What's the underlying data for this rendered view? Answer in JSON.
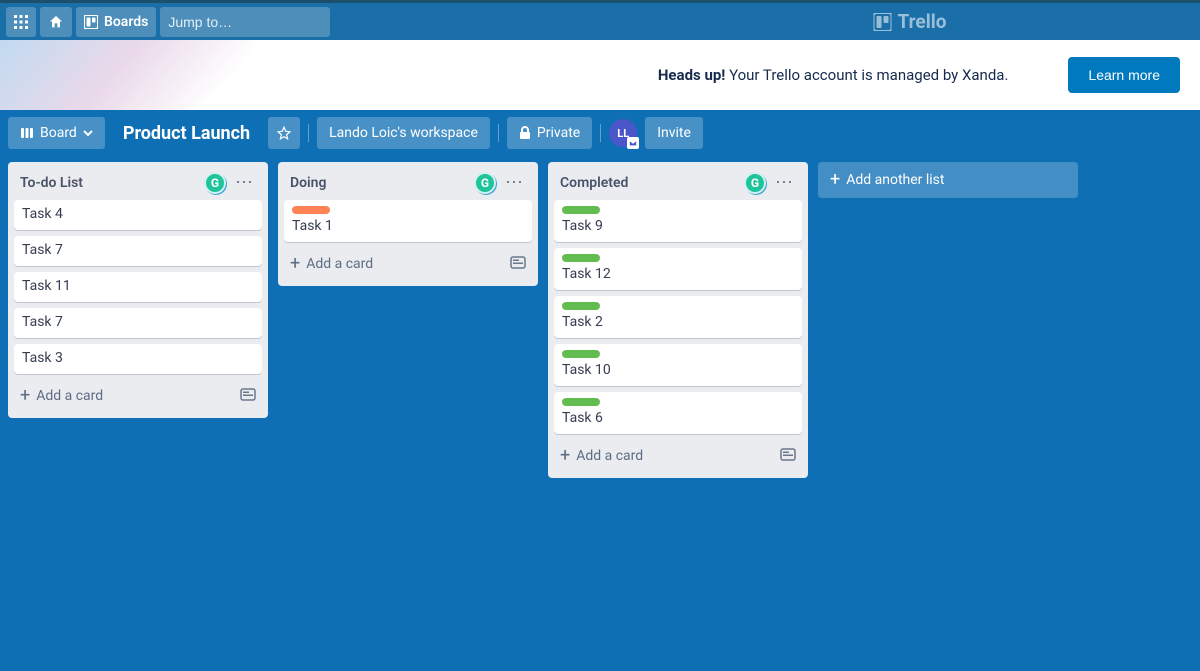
{
  "topbar": {
    "boards_label": "Boards",
    "search_placeholder": "Jump to…",
    "brand": "Trello"
  },
  "banner": {
    "bold": "Heads up!",
    "text": " Your Trello account is managed by Xanda.",
    "button": "Learn more"
  },
  "boardheader": {
    "board_btn": "Board",
    "board_name": "Product Launch",
    "workspace": "Lando Loic's workspace",
    "visibility": "Private",
    "avatar": "LL",
    "invite": "Invite"
  },
  "lists": [
    {
      "title": "To-do List",
      "cards": [
        {
          "title": "Task 4",
          "label": null
        },
        {
          "title": "Task 7",
          "label": null
        },
        {
          "title": "Task 11",
          "label": null
        },
        {
          "title": "Task 7",
          "label": null
        },
        {
          "title": "Task 3",
          "label": null
        }
      ]
    },
    {
      "title": "Doing",
      "cards": [
        {
          "title": "Task 1",
          "label": "orange"
        }
      ]
    },
    {
      "title": "Completed",
      "cards": [
        {
          "title": "Task 9",
          "label": "green"
        },
        {
          "title": "Task 12",
          "label": "green"
        },
        {
          "title": "Task 2",
          "label": "green"
        },
        {
          "title": "Task 10",
          "label": "green"
        },
        {
          "title": "Task 6",
          "label": "green"
        }
      ]
    }
  ],
  "strings": {
    "add_card": "Add a card",
    "add_list": "Add another list"
  }
}
